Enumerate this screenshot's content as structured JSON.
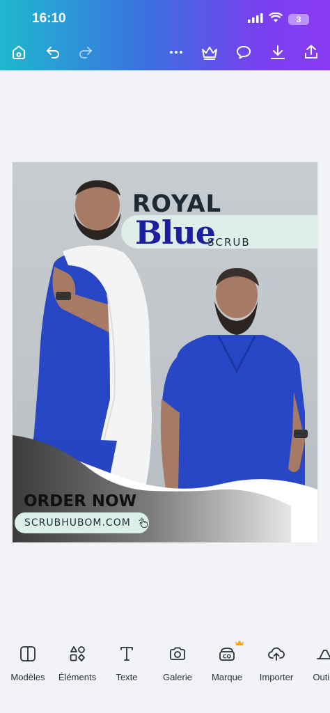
{
  "status_bar": {
    "time": "16:10",
    "battery": "3"
  },
  "toolbar": {
    "items": [
      {
        "icon": "home-icon"
      },
      {
        "icon": "undo-icon"
      },
      {
        "icon": "redo-icon"
      },
      {
        "icon": "more-icon"
      },
      {
        "icon": "crown-icon"
      },
      {
        "icon": "comment-icon"
      },
      {
        "icon": "download-icon"
      },
      {
        "icon": "share-icon"
      }
    ]
  },
  "design": {
    "title_line1": "ROYAL",
    "title_main": "Blue",
    "title_suffix": "SCRUB",
    "cta": "ORDER NOW",
    "url": "SCRUBHUBOM.COM"
  },
  "bottom_bar": {
    "items": [
      {
        "label": "Modèles",
        "icon": "layout-icon"
      },
      {
        "label": "Éléments",
        "icon": "elements-icon"
      },
      {
        "label": "Texte",
        "icon": "text-icon"
      },
      {
        "label": "Galerie",
        "icon": "camera-icon"
      },
      {
        "label": "Marque",
        "icon": "brand-icon"
      },
      {
        "label": "Importer",
        "icon": "upload-icon"
      },
      {
        "label": "Outils",
        "icon": "tools-icon"
      }
    ]
  },
  "colors": {
    "header_gradient_start": "#1fb8cf",
    "header_gradient_end": "#8a3cf2",
    "scrub_blue": "#2747c7",
    "title_blue": "#1b1fa0",
    "pro_crown": "#f5a623"
  }
}
